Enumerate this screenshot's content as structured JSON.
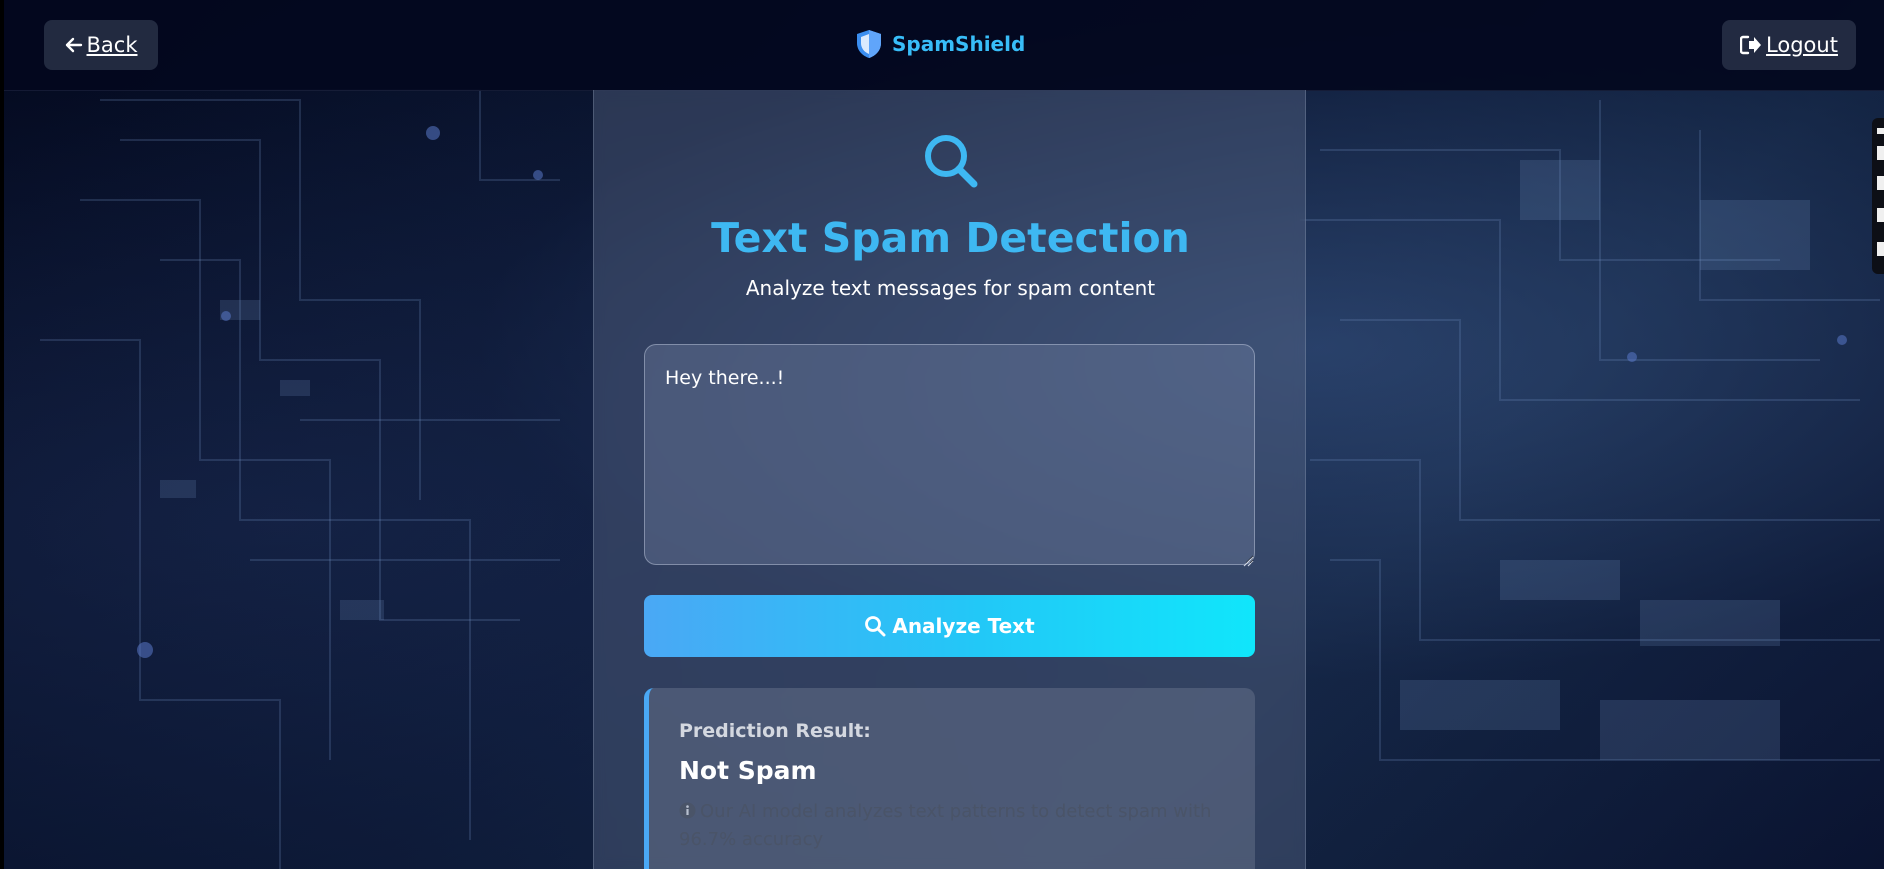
{
  "header": {
    "back_label": "Back",
    "brand_name": "SpamShield",
    "logout_label": "Logout"
  },
  "card": {
    "title": "Text Spam Detection",
    "subtitle": "Analyze text messages for spam content",
    "message_value": "Hey there...!",
    "analyze_label": "Analyze Text",
    "result": {
      "label": "Prediction Result:",
      "value": "Not Spam",
      "note": "Our AI model analyzes text patterns to detect spam with 96.7% accuracy"
    }
  },
  "icons": {
    "back": "arrow-left-icon",
    "brand": "shield-icon",
    "logout": "sign-out-icon",
    "card": "magnifier-icon",
    "analyze": "search-icon",
    "info": "info-circle-icon"
  },
  "colors": {
    "accent": "#3eb8f2",
    "button_gradient_start": "#4aa8f5",
    "button_gradient_end": "#10e6fb",
    "header_bg": "#03081e"
  }
}
